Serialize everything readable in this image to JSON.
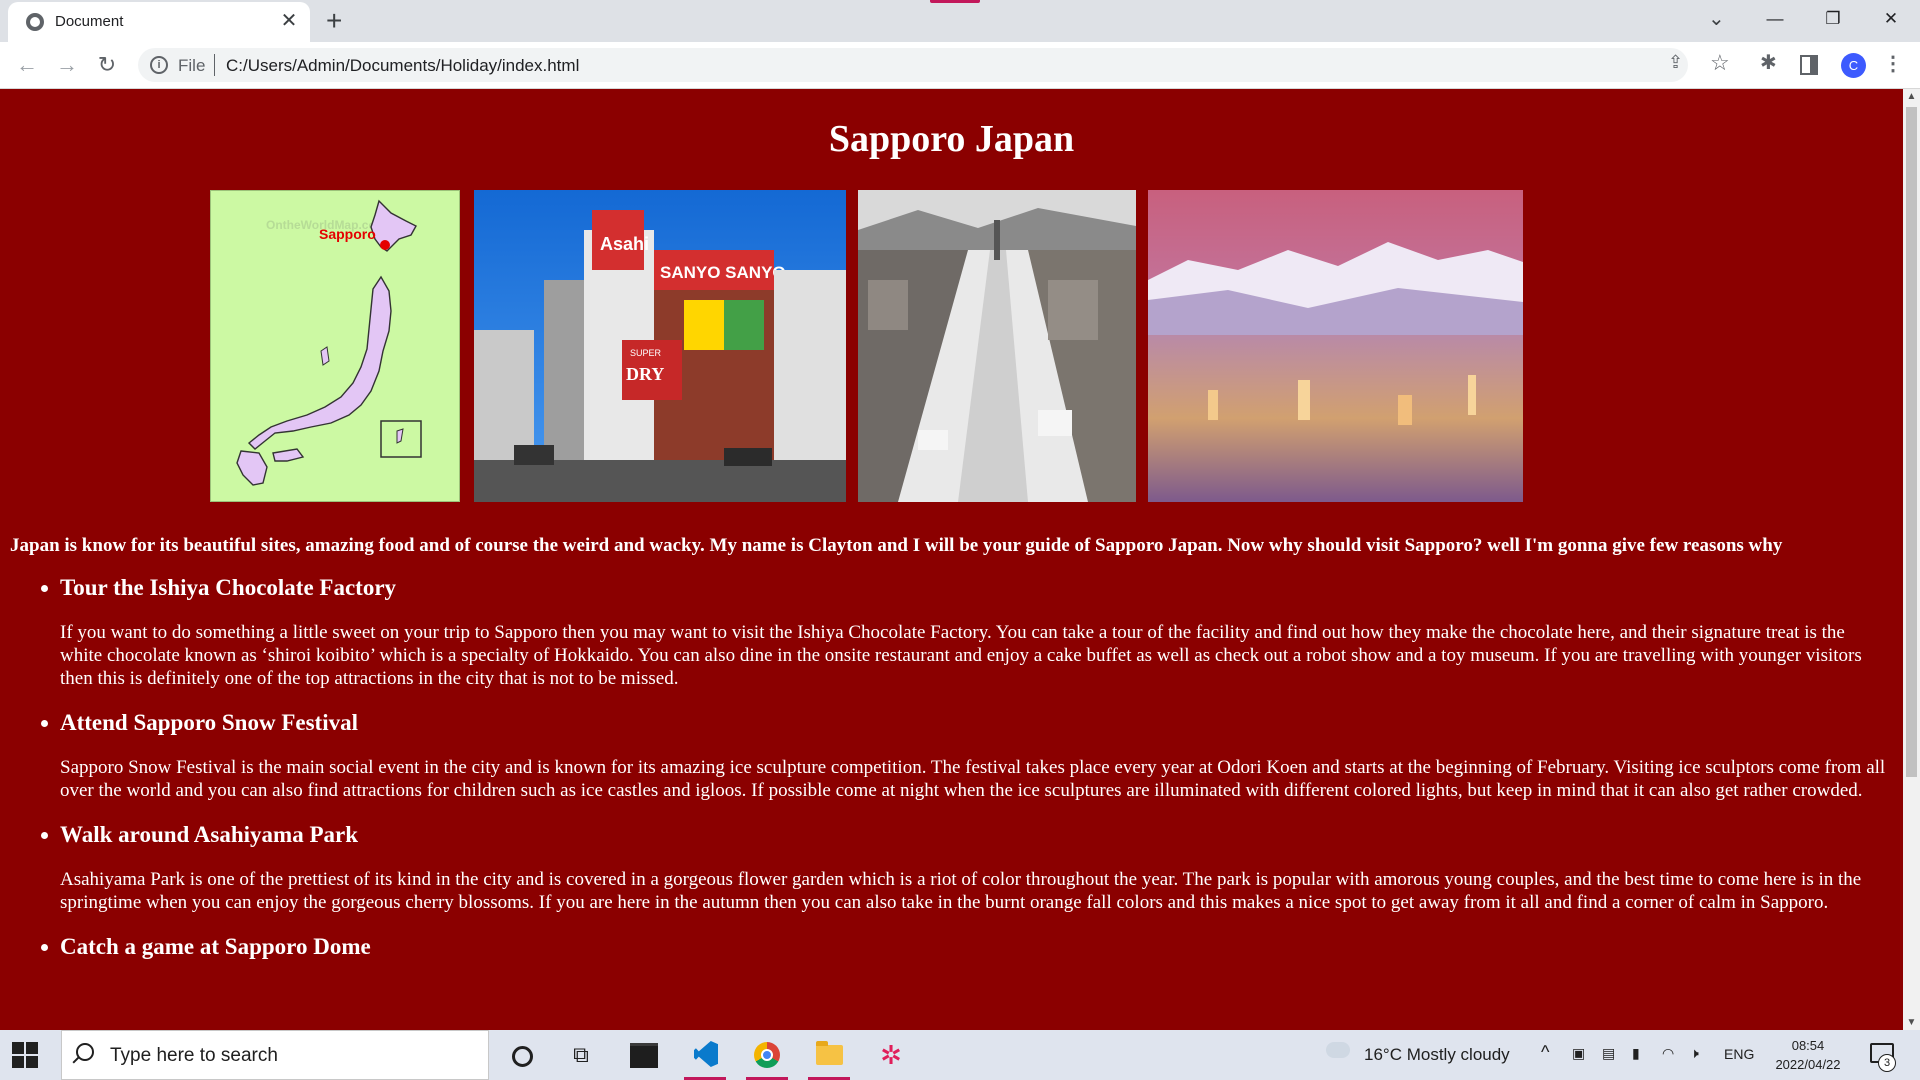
{
  "browser": {
    "tab_title": "Document",
    "tab_close": "✕",
    "new_tab": "+",
    "tab_search": "⌄",
    "window": {
      "minimize": "—",
      "maximize": "❐",
      "close": "✕"
    },
    "nav": {
      "back": "←",
      "forward": "→",
      "reload": "↻"
    },
    "omnibox": {
      "info": "i",
      "scheme": "File",
      "url": "C:/Users/Admin/Documents/Holiday/index.html"
    },
    "actions": {
      "share": "⇪",
      "star": "☆",
      "extensions": "✱",
      "menu": "⋮"
    },
    "profile_initial": "C"
  },
  "page": {
    "title": "Sapporo Japan",
    "map_label": "Sapporo",
    "map_watermark": "OntheWorldMap.com",
    "street_signs": [
      "Asahi",
      "SANYO SANYO",
      "DRY",
      "SUPER"
    ],
    "intro": "Japan is know for its beautiful sites, amazing food and of course the weird and wacky. My name is Clayton and I will be your guide of Sapporo Japan. Now why should visit Sapporo? well I'm gonna give few reasons why",
    "attractions": [
      {
        "title": "Tour the Ishiya Chocolate Factory",
        "text": "If you want to do something a little sweet on your trip to Sapporo then you may want to visit the Ishiya Chocolate Factory. You can take a tour of the facility and find out how they make the chocolate here, and their signature treat is the white chocolate known as ‘shiroi koibito’ which is a specialty of Hokkaido. You can also dine in the onsite restaurant and enjoy a cake buffet as well as check out a robot show and a toy museum. If you are travelling with younger visitors then this is definitely one of the top attractions in the city that is not to be missed."
      },
      {
        "title": "Attend Sapporo Snow Festival",
        "text": "Sapporo Snow Festival is the main social event in the city and is known for its amazing ice sculpture competition. The festival takes place every year at Odori Koen and starts at the beginning of February. Visiting ice sculptors come from all over the world and you can also find attractions for children such as ice castles and igloos. If possible come at night when the ice sculptures are illuminated with different colored lights, but keep in mind that it can also get rather crowded."
      },
      {
        "title": "Walk around Asahiyama Park",
        "text": "Asahiyama Park is one of the prettiest of its kind in the city and is covered in a gorgeous flower garden which is a riot of color throughout the year. The park is popular with amorous young couples, and the best time to come here is in the springtime when you can enjoy the gorgeous cherry blossoms. If you are here in the autumn then you can also take in the burnt orange fall colors and this makes a nice spot to get away from it all and find a corner of calm in Sapporo."
      },
      {
        "title": "Catch a game at Sapporo Dome",
        "text": ""
      }
    ]
  },
  "taskbar": {
    "search_placeholder": "Type here to search",
    "taskview": "⧉",
    "slack": "✲",
    "weather": "16°C  Mostly cloudy",
    "tray_chevron": "^",
    "tray_meet": "▣",
    "tray_display": "▤",
    "tray_battery": "▮",
    "tray_wifi": "◠",
    "tray_volume": "🕨",
    "language": "ENG",
    "time": "08:54",
    "date": "2022/04/22",
    "notifications": "3"
  },
  "colors": {
    "page_background": "#8b0000",
    "accent": "#c2185b"
  }
}
